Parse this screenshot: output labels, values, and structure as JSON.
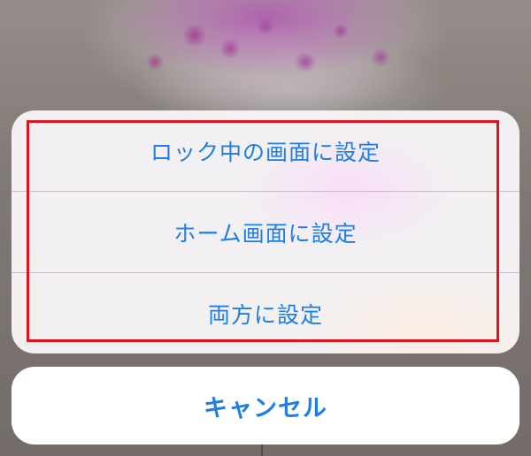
{
  "action_sheet": {
    "actions": [
      {
        "label": "ロック中の画面に設定"
      },
      {
        "label": "ホーム画面に設定"
      },
      {
        "label": "両方に設定"
      }
    ],
    "cancel_label": "キャンセル"
  },
  "colors": {
    "action_text": "#1f7fe0",
    "highlight_border": "#e0141e",
    "sheet_background": "#f6f4f6",
    "cancel_background": "#ffffff"
  }
}
